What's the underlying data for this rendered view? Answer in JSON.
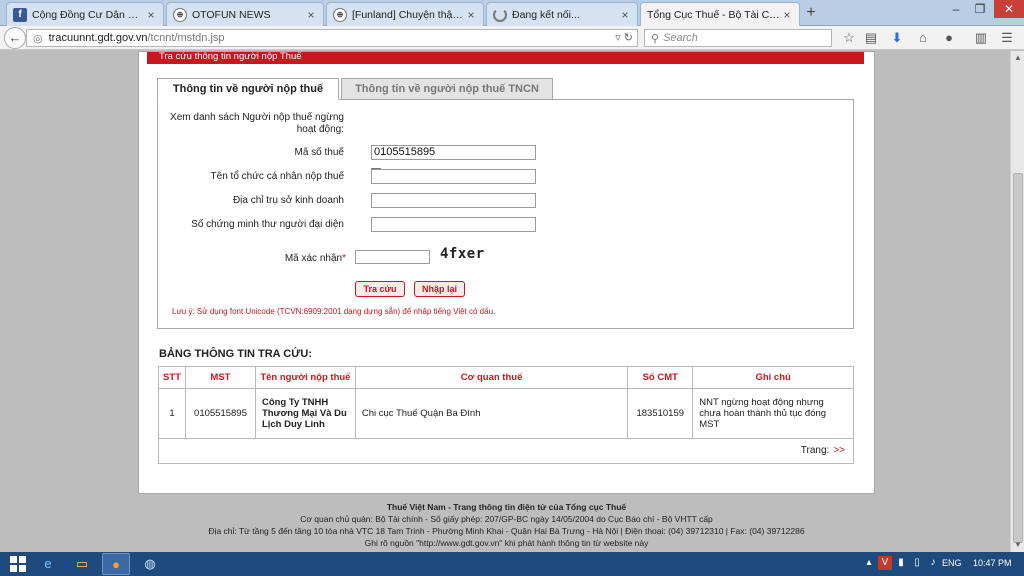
{
  "browser": {
    "tabs": [
      {
        "label": "Cộng Đồng Cư Dân HH Lin...",
        "icon": "facebook-icon",
        "active": false
      },
      {
        "label": "OTOFUN NEWS",
        "icon": "otofun-icon",
        "active": false
      },
      {
        "label": "[Funland] Chuyện thật mà ...",
        "icon": "otofun-icon",
        "active": false
      },
      {
        "label": "Đang kết nối...",
        "icon": "loading-icon",
        "active": false
      },
      {
        "label": "Tổng Cục Thuế - Bộ Tài Chính",
        "icon": "",
        "active": true
      }
    ],
    "new_tab": "+",
    "url_host": "tracuunnt.gdt.gov.vn",
    "url_path": "/tcnnt/mstdn.jsp",
    "search_placeholder": "Search"
  },
  "page": {
    "section_header": "Tra cứu thông tin người nộp Thuế",
    "tabs": [
      {
        "label": "Thông tin về người nộp thuế",
        "active": true
      },
      {
        "label": "Thông tin về người nộp thuế TNCN",
        "active": false
      }
    ],
    "form": {
      "inactive_label": "Xem danh sách Người nộp thuế ngừng hoạt động:",
      "mst_label": "Mã số thuế",
      "mst_value": "0105515895",
      "name_label": "Tên tổ chức cá nhân nộp thuế",
      "name_value": "",
      "address_label": "Địa chỉ trụ sở kinh doanh",
      "address_value": "",
      "id_label": "Số chứng minh thư người đại diện",
      "id_value": "",
      "captcha_label": "Mã xác nhận",
      "captcha_required": "*",
      "captcha_text": "4fxer",
      "search_button": "Tra cứu",
      "reset_button": "Nhập lại",
      "note": "Lưu ý: Sử dụng font Unicode (TCVN:6909:2001 dạng dựng sẵn) để nhập tiếng Việt có dấu."
    },
    "results": {
      "title": "BẢNG THÔNG TIN TRA CỨU:",
      "columns": [
        "STT",
        "MST",
        "Tên người nộp thuế",
        "Cơ quan thuế",
        "Số CMT",
        "Ghi chú"
      ],
      "rows": [
        [
          "1",
          "0105515895",
          "Công Ty TNHH Thương Mại Và Du Lịch Duy Linh",
          "Chi cục Thuế Quận Ba Đình",
          "183510159",
          "NNT ngừng hoạt động nhưng chưa hoàn thành thủ tục đóng MST"
        ]
      ],
      "pager_label": "Trang:",
      "pager_next": ">>"
    },
    "footer": {
      "line1": "Thuế Việt Nam - Trang thông tin điện tử của Tổng cục Thuế",
      "line2": "Cơ quan chủ quản: Bộ Tài chính - Số giấy phép: 207/GP-BC ngày 14/05/2004 do Cục Báo chí - Bộ VHTT cấp",
      "line3": "Địa chỉ: Từ tầng 5 đến tầng 10 tòa nhà VTC 18 Tam Trinh - Phường Minh Khai - Quận Hai Bà Trưng - Hà Nội | Điện thoại: (04) 39712310 | Fax: (04) 39712286",
      "line4": "Ghi rõ nguồn \"http://www.gdt.gov.vn\" khi phát hành thông tin từ website này"
    }
  },
  "taskbar": {
    "language": "ENG",
    "clock": "10:47 PM"
  },
  "colors": {
    "accent_red": "#c8171e",
    "taskbar_blue": "#1f4a7d"
  }
}
